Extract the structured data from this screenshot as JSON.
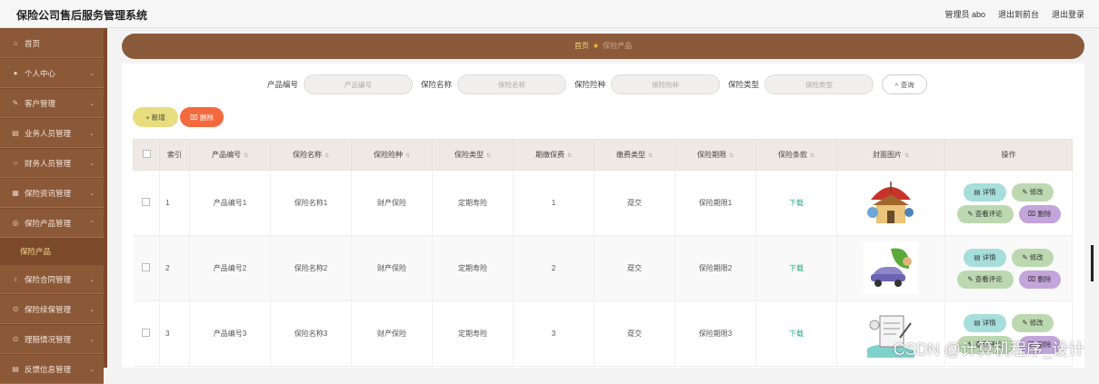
{
  "header": {
    "title": "保险公司售后服务管理系统",
    "admin": "管理员 abo",
    "front": "退出到前台",
    "logout": "退出登录"
  },
  "sidebar": {
    "items": [
      {
        "label": "首页",
        "icon": "home-icon"
      },
      {
        "label": "个人中心",
        "icon": "user-icon"
      },
      {
        "label": "客户管理",
        "icon": "customer-icon"
      },
      {
        "label": "业务人员管理",
        "icon": "staff-icon"
      },
      {
        "label": "财务人员管理",
        "icon": "finance-icon"
      },
      {
        "label": "保险资讯管理",
        "icon": "news-icon"
      },
      {
        "label": "保险产品管理",
        "icon": "product-icon",
        "sub": "保险产品"
      },
      {
        "label": "保险合同管理",
        "icon": "contract-icon"
      },
      {
        "label": "保险续保管理",
        "icon": "renewal-icon"
      },
      {
        "label": "理赔情况管理",
        "icon": "claim-icon"
      },
      {
        "label": "反馈信息管理",
        "icon": "feedback-icon"
      }
    ]
  },
  "breadcrumb": {
    "home": "首页",
    "current": "保险产品"
  },
  "search": {
    "fields": [
      {
        "label": "产品编号",
        "placeholder": "产品编号"
      },
      {
        "label": "保险名称",
        "placeholder": "保险名称"
      },
      {
        "label": "保险险种",
        "placeholder": "保险险种"
      },
      {
        "label": "保险类型",
        "placeholder": "保险类型"
      }
    ],
    "button": "查询"
  },
  "actions": {
    "add": "新增",
    "delete": "删除"
  },
  "table": {
    "headers": [
      "索引",
      "产品编号",
      "保险名称",
      "保险险种",
      "保险类型",
      "期缴保费",
      "缴费类型",
      "保险期限",
      "保险条款",
      "封面图片",
      "操作"
    ],
    "rows": [
      {
        "index": "1",
        "code": "产品编号1",
        "name": "保险名称1",
        "kind": "财产保险",
        "type": "定期寿险",
        "premium": "1",
        "payType": "趸交",
        "period": "保险期限1",
        "terms": "下载"
      },
      {
        "index": "2",
        "code": "产品编号2",
        "name": "保险名称2",
        "kind": "财产保险",
        "type": "定期寿险",
        "premium": "2",
        "payType": "趸交",
        "period": "保险期限2",
        "terms": "下载"
      },
      {
        "index": "3",
        "code": "产品编号3",
        "name": "保险名称3",
        "kind": "财产保险",
        "type": "定期寿险",
        "premium": "3",
        "payType": "趸交",
        "period": "保险期限3",
        "terms": "下载"
      }
    ],
    "ops": {
      "detail": "详情",
      "edit": "修改",
      "comment": "查看评论",
      "delete": "删除"
    }
  },
  "watermark": "CSDN @计算机程序_设计"
}
